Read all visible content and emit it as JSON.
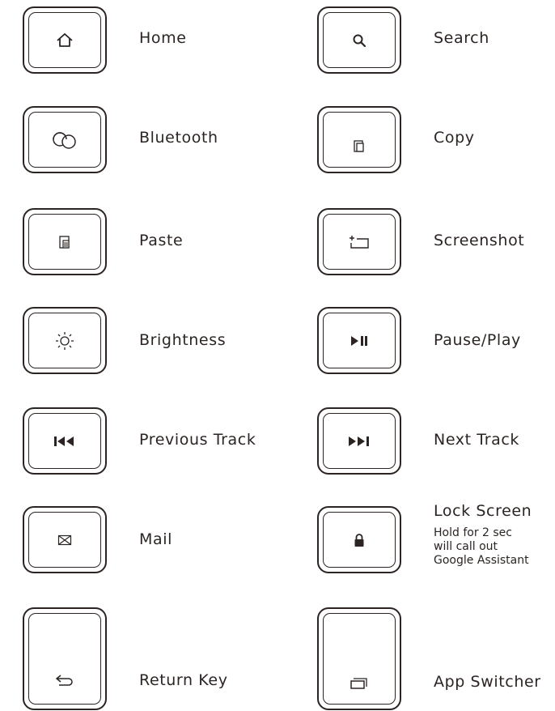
{
  "keys": {
    "home": {
      "label": "Home",
      "icon": "home-icon"
    },
    "search": {
      "label": "Search",
      "icon": "search-icon"
    },
    "bluetooth": {
      "label": "Bluetooth",
      "icon": "bluetooth-icon"
    },
    "copy": {
      "label": "Copy",
      "icon": "copy-icon"
    },
    "paste": {
      "label": "Paste",
      "icon": "paste-icon"
    },
    "screenshot": {
      "label": "Screenshot",
      "icon": "screenshot-icon"
    },
    "brightness": {
      "label": "Brightness",
      "icon": "brightness-icon"
    },
    "pause_play": {
      "label": "Pause/Play",
      "icon": "play-pause-icon"
    },
    "previous_track": {
      "label": "Previous Track",
      "icon": "previous-track-icon"
    },
    "next_track": {
      "label": "Next Track",
      "icon": "next-track-icon"
    },
    "mail": {
      "label": "Mail",
      "icon": "mail-icon"
    },
    "lock_screen": {
      "label": "Lock Screen",
      "note_line1": "Hold for 2 sec",
      "note_line2": "will call out",
      "note_line3": "Google Assistant",
      "icon": "lock-icon"
    },
    "return_key": {
      "label": "Return Key",
      "icon": "return-icon"
    },
    "app_switcher": {
      "label": "App Switcher",
      "icon": "app-switcher-icon"
    }
  },
  "colors": {
    "ink": "#2b2422",
    "background": "#ffffff"
  }
}
